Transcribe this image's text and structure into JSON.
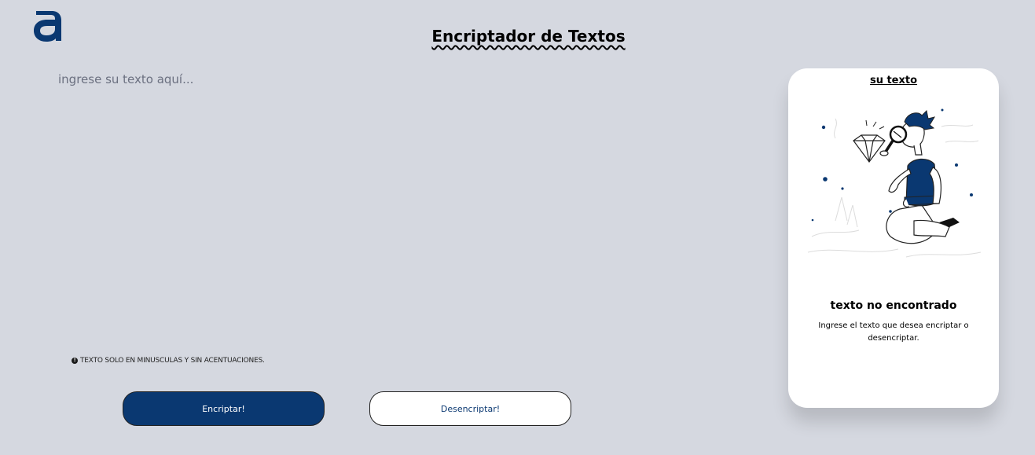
{
  "header": {
    "logo": "alura-logo",
    "title": "Encriptador de Textos"
  },
  "input": {
    "placeholder": "ingrese su texto aquí...",
    "value": ""
  },
  "hint": {
    "icon": "info-icon",
    "text": "TEXTO SOLO EN MINUSCULAS Y SIN ACENTUACIONES."
  },
  "buttons": {
    "encrypt_label": "Encriptar!",
    "decrypt_label": "Desencriptar!"
  },
  "output": {
    "title": "su texto",
    "illustration": "person-with-magnifying-glass-illustration",
    "empty_title": "texto no encontrado",
    "empty_description": "Ingrese el texto que desea encriptar o desencriptar."
  },
  "colors": {
    "background": "#d5d8e0",
    "primary": "#0a3871",
    "card": "#ffffff"
  }
}
